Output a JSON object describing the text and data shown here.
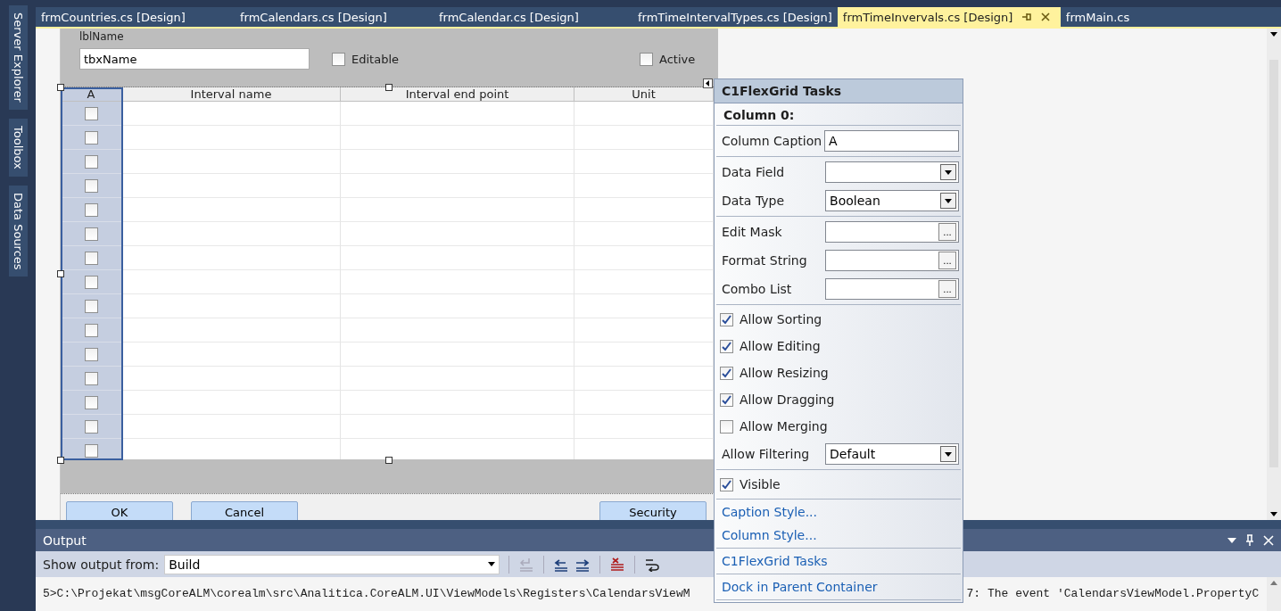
{
  "side_tabs": [
    "Server Explorer",
    "Toolbox",
    "Data Sources"
  ],
  "doc_tabs": [
    {
      "label": "frmCountries.cs [Design]",
      "selected": false
    },
    {
      "label": "frmCalendars.cs [Design]",
      "selected": false
    },
    {
      "label": "frmCalendar.cs [Design]",
      "selected": false
    },
    {
      "label": "frmTimeIntervalTypes.cs [Design]",
      "selected": false
    },
    {
      "label": "frmTimeInvervals.cs [Design]",
      "selected": true
    },
    {
      "label": "frmMain.cs",
      "selected": false
    }
  ],
  "form": {
    "name_label": "lblName",
    "name_field": {
      "value": "tbxName"
    },
    "checkboxes": [
      {
        "label": "Editable",
        "checked": false
      },
      {
        "label": "Active",
        "checked": false
      }
    ],
    "grid": {
      "columns": [
        "A",
        "Interval name",
        "Interval end point",
        "Unit"
      ],
      "row_checks": [
        false,
        false,
        false,
        false,
        false,
        false,
        false,
        false,
        false,
        false,
        false,
        false,
        false,
        false,
        false
      ]
    },
    "buttons": [
      "OK",
      "Cancel",
      "Security"
    ]
  },
  "tasks_panel": {
    "title": "C1FlexGrid Tasks",
    "section": "Column 0:",
    "groups": [
      [
        {
          "kind": "text",
          "label": "Column Caption",
          "value": "A"
        }
      ],
      [
        {
          "kind": "dropdown",
          "label": "Data Field"
        },
        {
          "kind": "dropdown",
          "label": "Data Type",
          "value": "Boolean"
        }
      ],
      [
        {
          "kind": "ellipsis",
          "label": "Edit Mask",
          "button": "..."
        },
        {
          "kind": "ellipsis",
          "label": "Format String",
          "button": "..."
        },
        {
          "kind": "ellipsis",
          "label": "Combo List",
          "button": "..."
        }
      ],
      [
        {
          "kind": "check",
          "label": "Allow Sorting",
          "checked": true
        },
        {
          "kind": "check",
          "label": "Allow Editing",
          "checked": true
        },
        {
          "kind": "check",
          "label": "Allow Resizing",
          "checked": true
        },
        {
          "kind": "check",
          "label": "Allow Dragging",
          "checked": true
        },
        {
          "kind": "check",
          "label": "Allow Merging",
          "checked": false
        },
        {
          "kind": "dropdown",
          "label": "Allow Filtering",
          "value": "Default"
        }
      ],
      [
        {
          "kind": "check",
          "label": "Visible",
          "checked": true
        }
      ],
      [
        {
          "kind": "link",
          "label": "Caption Style..."
        },
        {
          "kind": "link",
          "label": "Column Style..."
        }
      ],
      [
        {
          "kind": "link",
          "label": "C1FlexGrid Tasks"
        }
      ],
      [
        {
          "kind": "link",
          "label": "Dock in Parent Container"
        }
      ]
    ]
  },
  "output": {
    "title": "Output",
    "source_label": "Show output from:",
    "source": "Build",
    "lines": [
      {
        "text": "5>C:\\Projekat\\msgCoreALM\\corealm\\src\\Analitica.CoreALM.UI\\ViewModels\\Registers\\CalendarsViewM",
        "tail": "7: The event 'CalendarsViewModel.PropertyC"
      }
    ]
  }
}
